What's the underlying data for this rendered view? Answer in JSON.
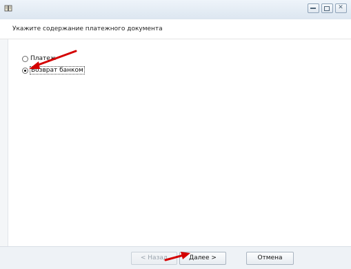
{
  "window": {
    "icon": "book-icon",
    "controls": [
      "minimize-icon",
      "maximize-icon",
      "close-icon"
    ]
  },
  "header": {
    "title": "Укажите содержание платежного документа"
  },
  "options": [
    {
      "label": "Платеж",
      "checked": false
    },
    {
      "label": "Возврат банком",
      "checked": true
    }
  ],
  "footer": {
    "back_label": "< Назад",
    "next_label": "Далее >",
    "cancel_label": "Отмена"
  },
  "colors": {
    "annotation_arrow": "#d40000"
  }
}
